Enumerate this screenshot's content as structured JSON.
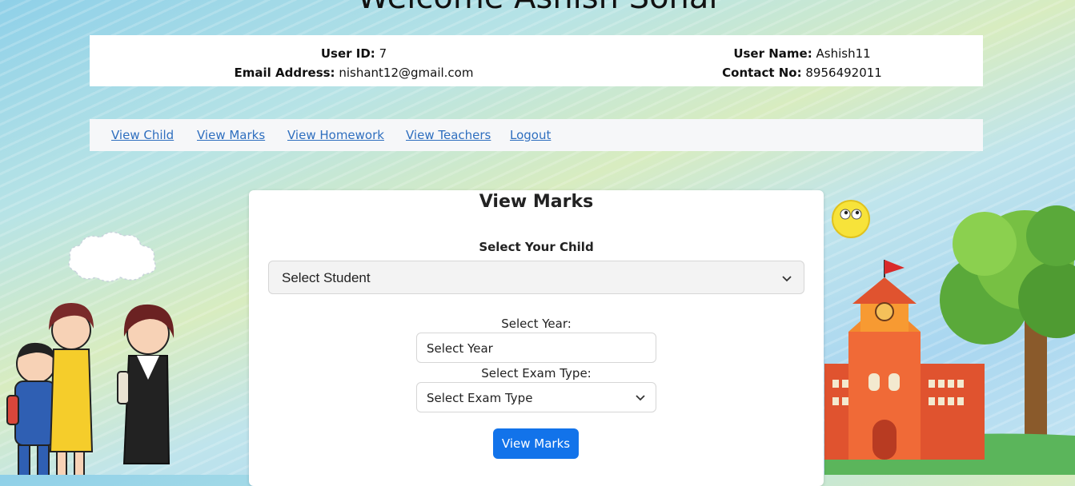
{
  "page": {
    "welcome": "Welcome Ashish Sohal"
  },
  "user_info": {
    "user_id_label": "User ID:",
    "user_id": "7",
    "email_label": "Email Address:",
    "email": "nishant12@gmail.com",
    "user_name_label": "User Name:",
    "user_name": "Ashish11",
    "contact_label": "Contact No:",
    "contact": "8956492011"
  },
  "nav": {
    "items": [
      "View Child",
      "View Marks",
      "View Homework",
      "View Teachers",
      "Logout"
    ]
  },
  "form": {
    "title": "View Marks",
    "child_label": "Select Your Child",
    "child_value": "Select Student",
    "year_label": "Select Year:",
    "year_value": "Select Year",
    "exam_label": "Select Exam Type:",
    "exam_value": "Select Exam Type",
    "submit_label": "View Marks"
  },
  "colors": {
    "primary": "#1273ea",
    "link": "#2f6fbf"
  }
}
